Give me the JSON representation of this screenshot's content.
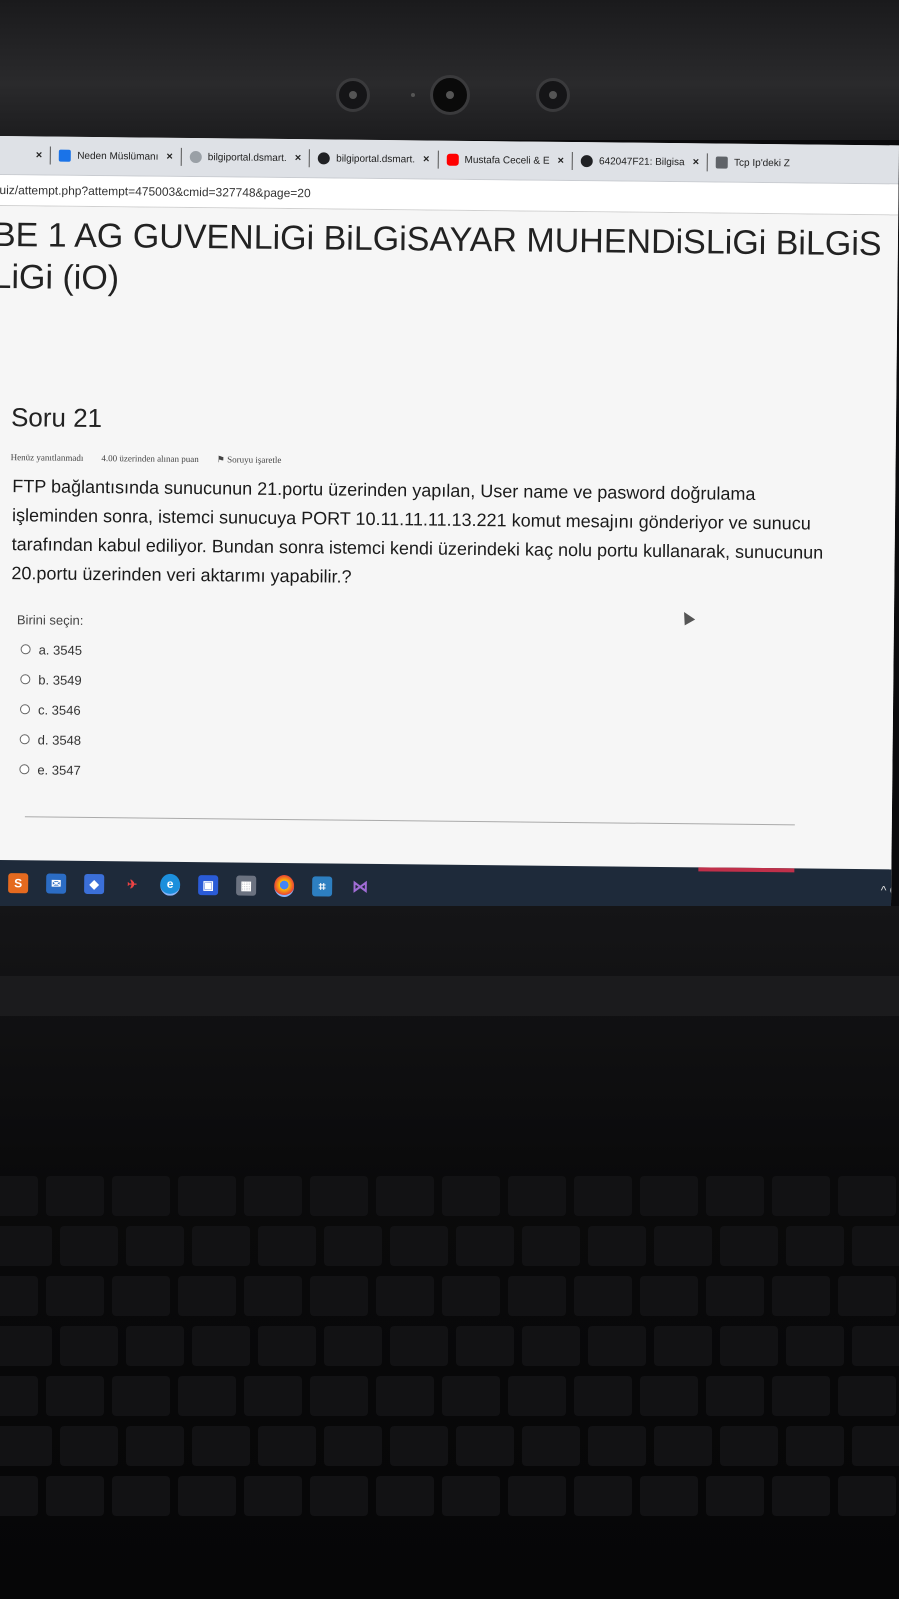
{
  "tabs": [
    {
      "title": "Neden Müslümanı",
      "favicon_color": "#1a73e8",
      "favicon": "c-icon"
    },
    {
      "title": "bilgiportal.dsmart.",
      "favicon_color": "#9aa0a6",
      "favicon": "globe-icon"
    },
    {
      "title": "bilgiportal.dsmart.",
      "favicon_color": "#202124",
      "favicon": "globe-icon"
    },
    {
      "title": "Mustafa Ceceli & E",
      "favicon_color": "#ff0000",
      "favicon": "youtube-icon"
    },
    {
      "title": "642047F21: Bilgisa",
      "favicon_color": "#202124",
      "favicon": "globe-icon"
    },
    {
      "title": "Tcp Ip'deki Z",
      "favicon_color": "#5f6368",
      "favicon": "doc-icon"
    }
  ],
  "tab_close": "×",
  "address": "uiz/attempt.php?attempt=475003&cmid=327748&page=20",
  "course_title_line1": "BE 1 AG GUVENLiGi BiLGiSAYAR MUHENDiSLiGi BiLGiS",
  "course_title_line2": "LiGi (iO)",
  "question": {
    "number": "Soru 21",
    "status": "Henüz yanıtlanmadı",
    "points": "4.00 üzerinden alınan puan",
    "flag": "Soruyu işaretle",
    "text": "FTP bağlantısında sunucunun 21.portu üzerinden yapılan, User name ve pasword doğrulama işleminden sonra, istemci sunucuya PORT 10.11.11.11.13.221 komut mesajını gönderiyor ve sunucu tarafından kabul ediliyor. Bundan sonra istemci kendi üzerindeki kaç nolu portu kullanarak, sunucunun 20.portu üzerinden veri aktarımı yapabilir.?",
    "choose_label": "Birini seçin:",
    "options": [
      "a. 3545",
      "b. 3549",
      "c. 3546",
      "d. 3548",
      "e. 3547"
    ]
  },
  "taskbar": {
    "tray": "^ Ö"
  }
}
